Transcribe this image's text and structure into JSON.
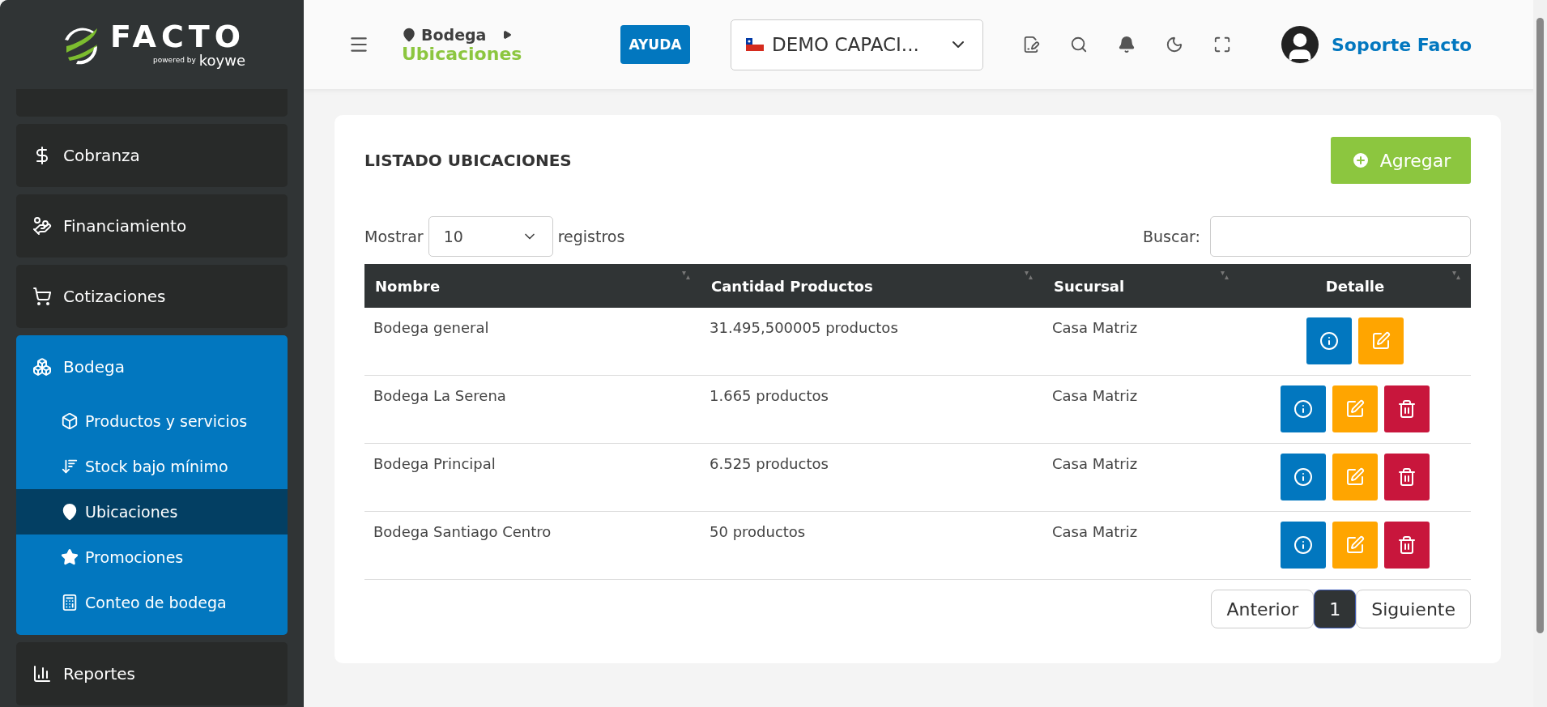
{
  "sidebar": {
    "logo": {
      "name": "FACTO",
      "powered": "powered by",
      "brand": "koywe"
    },
    "items": [
      {
        "label": "Cobranza",
        "expanded": false
      },
      {
        "label": "Financiamiento",
        "expanded": false
      },
      {
        "label": "Cotizaciones",
        "expanded": false
      },
      {
        "label": "Bodega",
        "expanded": true,
        "children": [
          {
            "label": "Productos y servicios",
            "selected": false
          },
          {
            "label": "Stock bajo mínimo",
            "selected": false
          },
          {
            "label": "Ubicaciones",
            "selected": true
          },
          {
            "label": "Promociones",
            "selected": false
          },
          {
            "label": "Conteo de bodega",
            "selected": false
          }
        ]
      },
      {
        "label": "Reportes",
        "expanded": false
      }
    ]
  },
  "header": {
    "breadcrumb": {
      "parent": "Bodega",
      "current": "Ubicaciones"
    },
    "help_button": "AYUDA",
    "company_select": "DEMO CAPACI...",
    "user": "Soporte Facto"
  },
  "listing": {
    "title": "LISTADO UBICACIONES",
    "add_button": "Agregar",
    "show_label": "Mostrar",
    "page_size": "10",
    "records_label": "registros",
    "search_label": "Buscar:",
    "columns": [
      "Nombre",
      "Cantidad Productos",
      "Sucursal",
      "Detalle"
    ],
    "rows": [
      {
        "name": "Bodega general",
        "quantity": "31.495,500005 productos",
        "branch": "Casa Matriz",
        "actions": [
          {
            "kind": "info"
          },
          {
            "kind": "edit"
          }
        ]
      },
      {
        "name": "Bodega La Serena",
        "quantity": "1.665 productos",
        "branch": "Casa Matriz",
        "actions": [
          {
            "kind": "info"
          },
          {
            "kind": "edit"
          },
          {
            "kind": "delete"
          }
        ]
      },
      {
        "name": "Bodega Principal",
        "quantity": "6.525 productos",
        "branch": "Casa Matriz",
        "actions": [
          {
            "kind": "info"
          },
          {
            "kind": "edit"
          },
          {
            "kind": "delete"
          }
        ]
      },
      {
        "name": "Bodega Santiago Centro",
        "quantity": "50 productos",
        "branch": "Casa Matriz",
        "actions": [
          {
            "kind": "info"
          },
          {
            "kind": "edit"
          },
          {
            "kind": "delete"
          }
        ]
      }
    ],
    "pagination": {
      "previous": "Anterior",
      "pages": [
        {
          "label": "1",
          "selected": true
        }
      ],
      "next": "Siguiente"
    }
  }
}
